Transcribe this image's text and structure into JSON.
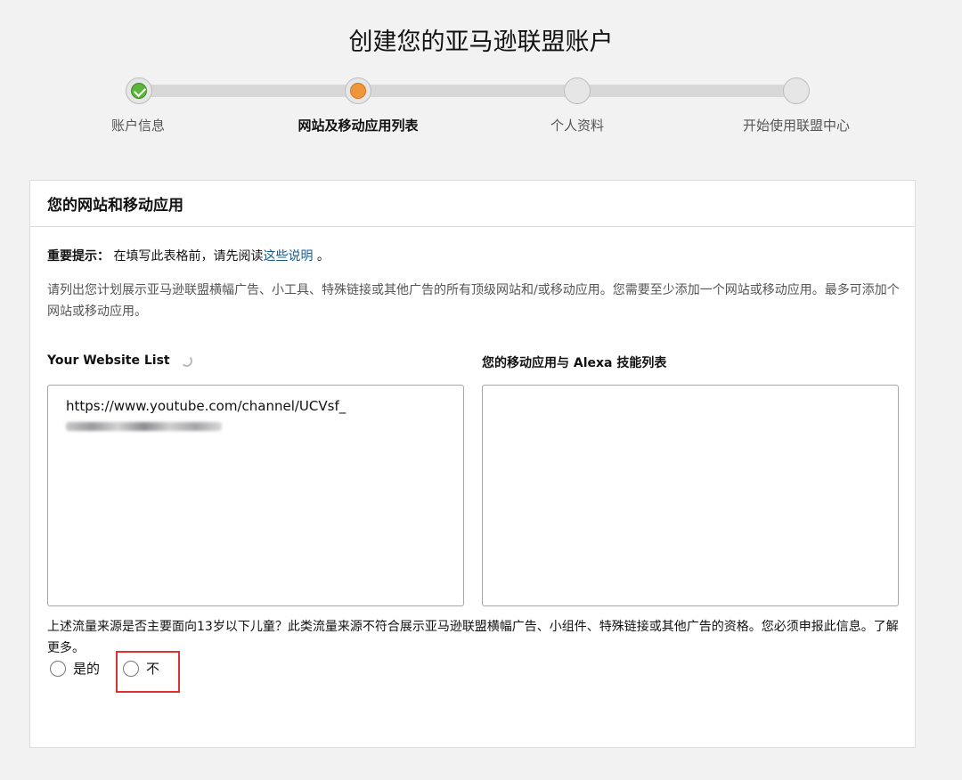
{
  "page": {
    "title": "创建您的亚马逊联盟账户"
  },
  "progress": {
    "steps": [
      {
        "label": "账户信息",
        "state": "done"
      },
      {
        "label": "网站及移动应用列表",
        "state": "current"
      },
      {
        "label": "个人资料",
        "state": "pending"
      },
      {
        "label": "开始使用联盟中心",
        "state": "pending"
      }
    ]
  },
  "panel": {
    "heading": "您的网站和移动应用",
    "notice_bold": "重要提示：",
    "notice_text": " 在填写此表格前，请先阅读",
    "notice_link": "这些说明",
    "notice_end": " 。",
    "description": "请列出您计划展示亚马逊联盟横幅广告、小工具、特殊链接或其他广告的所有顶级网站和/或移动应用。您需要至少添加一个网站或移动应用。最多可添加个网站或移动应用。",
    "website_list_label": "Your Website List",
    "app_list_label": "您的移动应用与 Alexa 技能列表",
    "website_list_value": "https://www.youtube.com/channel/UCVsf_",
    "app_list_value": "",
    "question": "上述流量来源是否主要面向13岁以下儿童？此类流量来源不符合展示亚马逊联盟横幅广告、小组件、特殊链接或其他广告的资格。您必须申报此信息。了解更多。",
    "option_yes": "是的",
    "option_no": "不"
  },
  "colors": {
    "done": "#5cb43c",
    "current": "#f0963a",
    "link": "#1a5c8e",
    "highlight": "#e0302f"
  }
}
